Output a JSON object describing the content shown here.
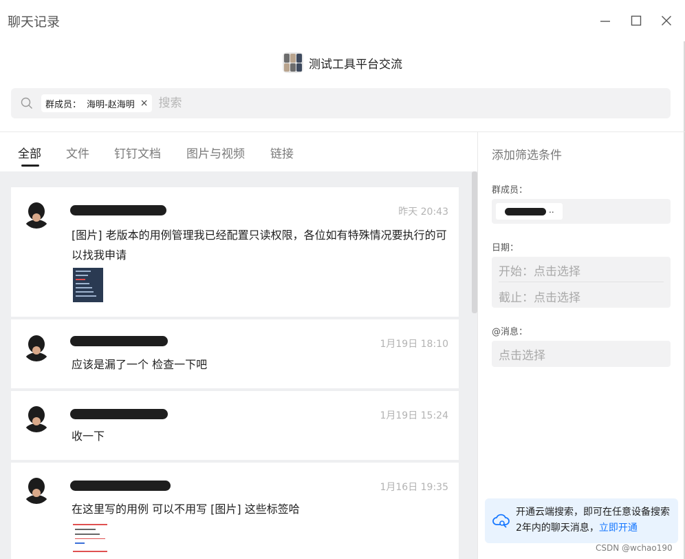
{
  "window": {
    "title": "聊天记录"
  },
  "group": {
    "name": "测试工具平台交流"
  },
  "search": {
    "chip_label": "群成员：",
    "chip_value": "海明-赵海明",
    "chip_close": "×",
    "placeholder": "搜索"
  },
  "tabs": [
    {
      "label": "全部",
      "active": true
    },
    {
      "label": "文件",
      "active": false
    },
    {
      "label": "钉钉文档",
      "active": false
    },
    {
      "label": "图片与视频",
      "active": false
    },
    {
      "label": "链接",
      "active": false
    }
  ],
  "messages": [
    {
      "time": "昨天 20:43",
      "text": "[图片] 老版本的用例管理我已经配置只读权限，各位如有特殊情况要执行的可以找我申请",
      "image_preview": "menu-screenshot"
    },
    {
      "time": "1月19日 18:10",
      "text": "应该是漏了一个 检查一下吧"
    },
    {
      "time": "1月19日 15:24",
      "text": "收一下"
    },
    {
      "time": "1月16日 19:35",
      "text": "在这里写的用例 可以不用写 [图片] 这些标签哈",
      "image_preview": "form-screenshot"
    }
  ],
  "filter": {
    "title": "添加筛选条件",
    "member_label": "群成员：",
    "member_suffix": "..",
    "date_label": "日期：",
    "date_start": "开始：点击选择",
    "date_end": "截止：点击选择",
    "mention_label": "@消息：",
    "mention_value": "点击选择"
  },
  "cloud": {
    "text": "开通云端搜索，即可在任意设备搜索2年内的聊天消息，",
    "link": "立即开通"
  },
  "watermark": "CSDN @wchao190",
  "colors": {
    "accent": "#1677ff",
    "panel": "#f2f2f3",
    "list_bg": "#eeeff1"
  }
}
